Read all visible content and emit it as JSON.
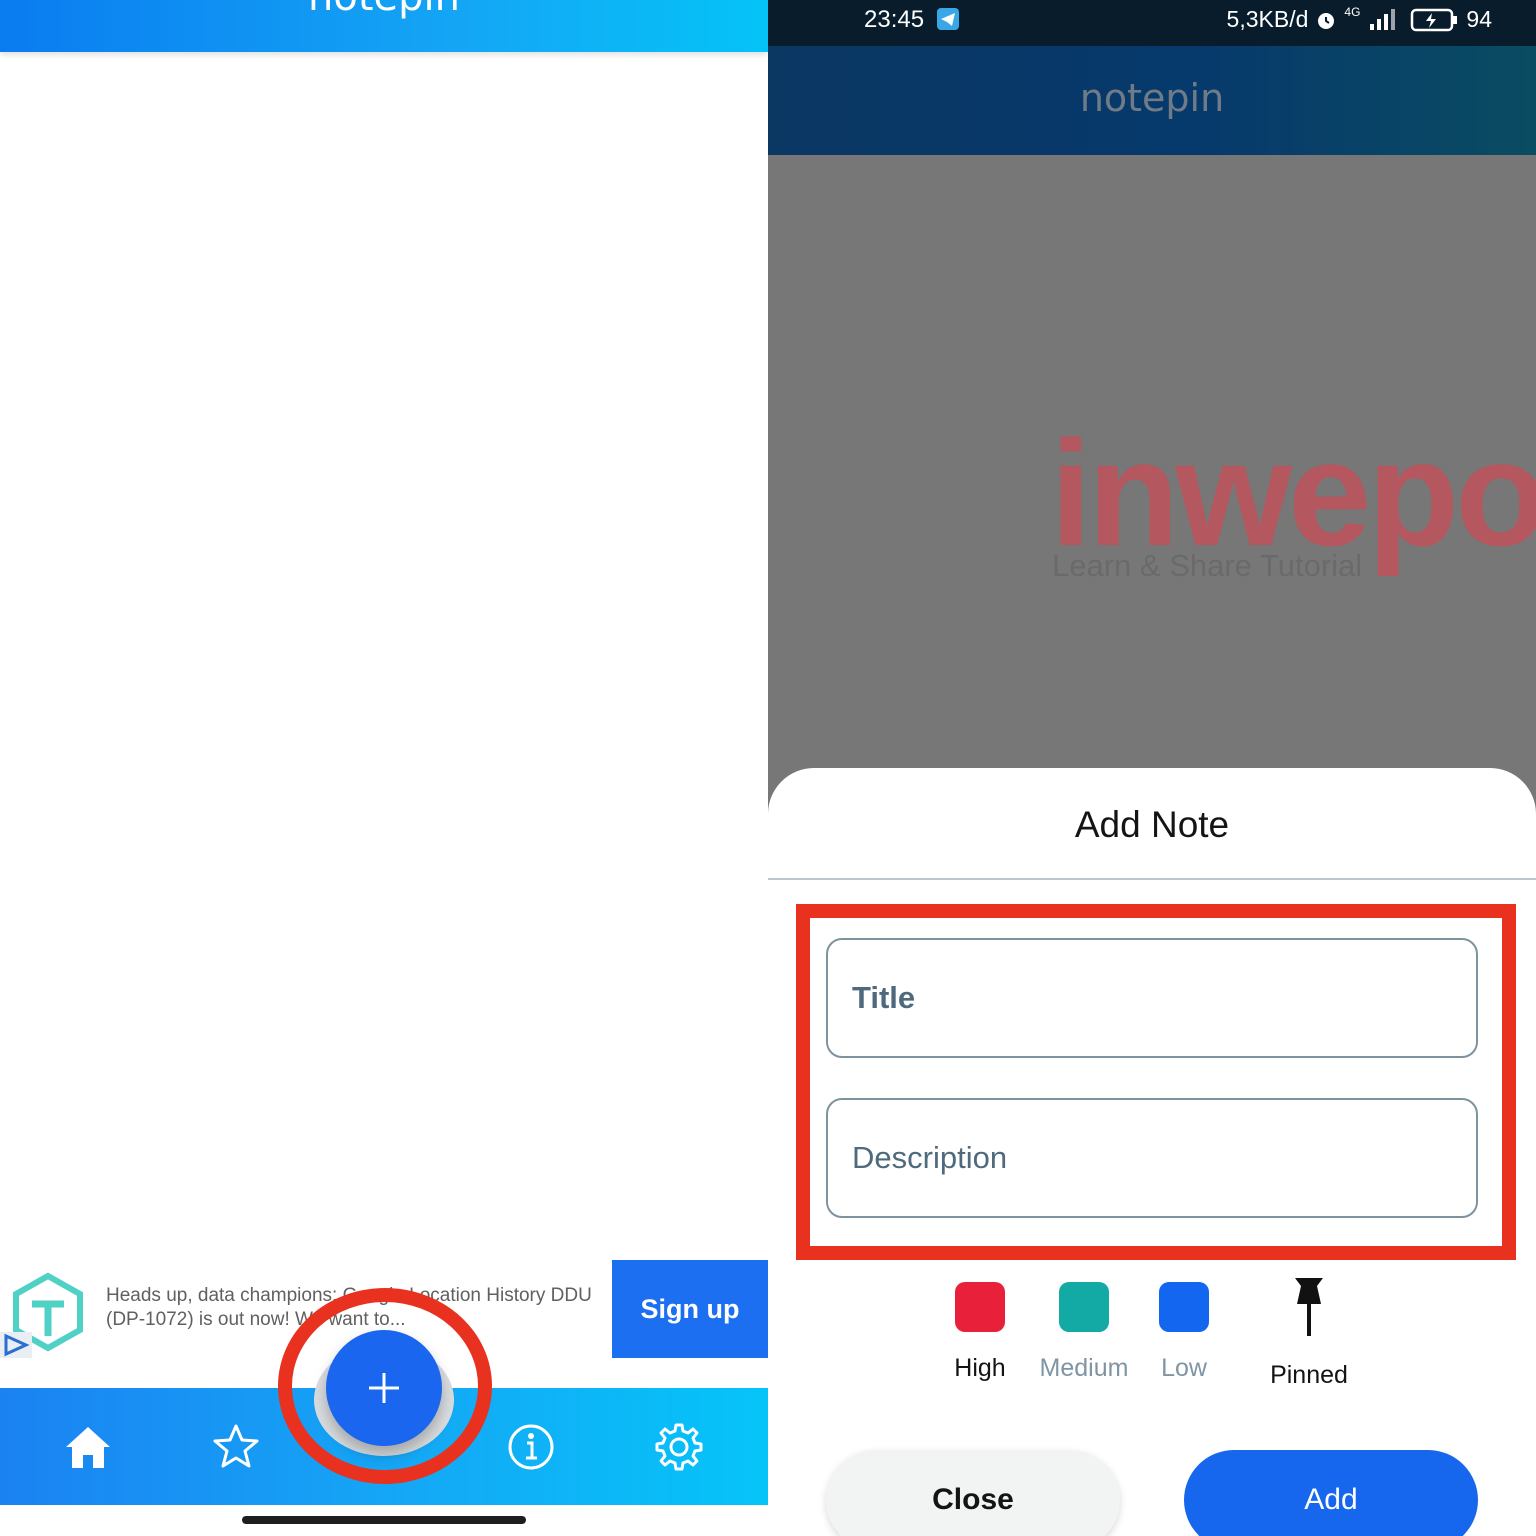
{
  "left_screen": {
    "app_title": "notepin",
    "ad": {
      "text": "Heads up, data champions: Google Location History DDU (DP-1072) is out now! We want to...",
      "cta": "Sign up"
    },
    "fab_icon": "plus-icon",
    "nav_icons": [
      "home-icon",
      "star-icon",
      "info-icon",
      "gear-icon"
    ],
    "colors": {
      "appbar": "#0a7cf0",
      "nav": "#14a9f6",
      "fab": "#1a66ee",
      "highlight": "#e8321f"
    }
  },
  "right_screen": {
    "status_bar": {
      "time": "23:45",
      "network": "5,3KB/d",
      "signal": "4G",
      "battery": "94"
    },
    "app_title": "notepin",
    "watermark": {
      "word": "inwepo",
      "tagline": "Learn & Share Tutorial"
    },
    "sheet": {
      "title": "Add Note",
      "title_placeholder": "Title",
      "description_placeholder": "Description",
      "priorities": [
        {
          "label": "High",
          "color": "#e8203a"
        },
        {
          "label": "Medium",
          "color": "#13aaa6"
        },
        {
          "label": "Low",
          "color": "#1266f0"
        }
      ],
      "pinned_label": "Pinned",
      "close_label": "Close",
      "add_label": "Add"
    }
  }
}
